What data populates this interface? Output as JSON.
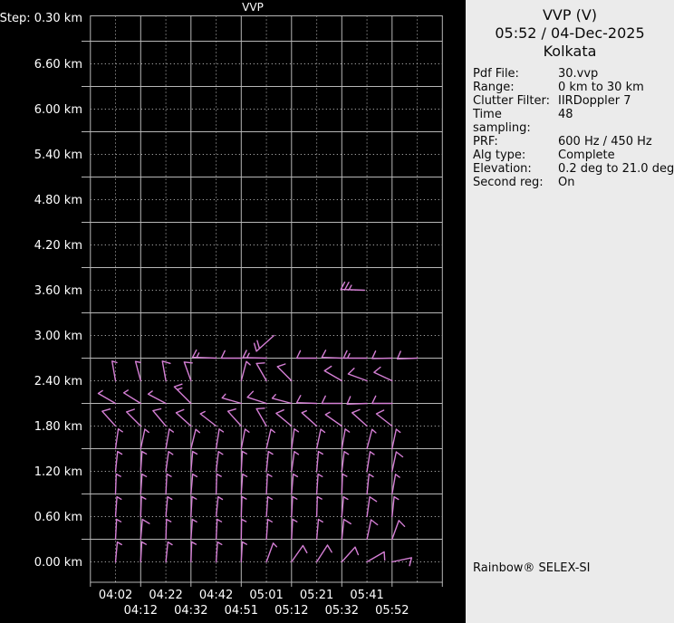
{
  "colors": {
    "background": "#000000",
    "grid_solid": "#b6b6b6",
    "grid_dotted": "#c6c6c6",
    "axis_text": "#ffffff",
    "barbs": "#d57fd5",
    "panel_bg": "#ebebeb",
    "panel_text": "#0a0a0a"
  },
  "chart": {
    "title": "VVP",
    "step_label": "Step: 0.30 km",
    "y_axis_labels": [
      "6.60 km",
      "6.00 km",
      "5.40 km",
      "4.80 km",
      "4.20 km",
      "3.60 km",
      "3.00 km",
      "2.40 km",
      "1.80 km",
      "1.20 km",
      "0.60 km",
      "0.00 km"
    ],
    "x_axis_row1": [
      "04:02",
      "04:22",
      "04:42",
      "05:01",
      "05:21",
      "05:41"
    ],
    "x_axis_row2": [
      "04:12",
      "04:32",
      "04:51",
      "05:12",
      "05:32",
      "05:52"
    ]
  },
  "panel": {
    "title": "VVP (V)",
    "datetime": "05:52 / 04-Dec-2025",
    "site": "Kolkata",
    "fields": [
      {
        "label": "Pdf File:",
        "value": "30.vvp"
      },
      {
        "label": "Range:",
        "value": "0 km to 30 km"
      },
      {
        "label": "Clutter Filter:",
        "value": "IIRDoppler 7"
      },
      {
        "label": "Time sampling:",
        "value": "48"
      },
      {
        "label": "PRF:",
        "value": "600 Hz / 450 Hz"
      },
      {
        "label": "Alg type:",
        "value": "Complete"
      },
      {
        "label": "Elevation:",
        "value": "0.2 deg to 21.0 deg"
      },
      {
        "label": "Second reg:",
        "value": "On"
      }
    ],
    "footer": "Rainbow® SELEX-SI"
  },
  "chart_data": {
    "type": "wind_barb_profile",
    "title": "VVP",
    "site": "Kolkata",
    "xlabel": "time",
    "ylabel": "height",
    "times": [
      "04:02",
      "04:12",
      "04:22",
      "04:32",
      "04:42",
      "04:51",
      "05:01",
      "05:12",
      "05:21",
      "05:32",
      "05:41",
      "05:52"
    ],
    "height_step_km": 0.3,
    "height_ticks_km": [
      6.6,
      6.0,
      5.4,
      4.8,
      4.2,
      3.6,
      3.0,
      2.4,
      1.8,
      1.2,
      0.6,
      0.0
    ],
    "ylim_km": [
      0.0,
      7.2
    ],
    "grid": "on",
    "barb_units": "kt",
    "barb_rows": [
      {
        "h": 0.0,
        "cells": [
          [
            1,
            5,
            5
          ],
          [
            2,
            3,
            5
          ],
          [
            3,
            6,
            5
          ],
          [
            4,
            2,
            5
          ],
          [
            5,
            4,
            5
          ],
          [
            6,
            3,
            5
          ],
          [
            7,
            20,
            5
          ],
          [
            8,
            35,
            10
          ],
          [
            9,
            33,
            10
          ],
          [
            10,
            42,
            10
          ],
          [
            11,
            60,
            10
          ],
          [
            12,
            78,
            10
          ]
        ]
      },
      {
        "h": 0.3,
        "cells": [
          [
            1,
            3,
            5
          ],
          [
            2,
            5,
            10
          ],
          [
            3,
            2,
            5
          ],
          [
            4,
            4,
            5
          ],
          [
            5,
            3,
            5
          ],
          [
            6,
            1,
            5
          ],
          [
            7,
            4,
            5
          ],
          [
            8,
            3,
            5
          ],
          [
            9,
            5,
            5
          ],
          [
            10,
            6,
            10
          ],
          [
            11,
            12,
            10
          ],
          [
            12,
            20,
            10
          ]
        ]
      },
      {
        "h": 0.6,
        "cells": [
          [
            1,
            4,
            5
          ],
          [
            2,
            2,
            5
          ],
          [
            3,
            5,
            5
          ],
          [
            4,
            3,
            5
          ],
          [
            5,
            6,
            5
          ],
          [
            6,
            2,
            5
          ],
          [
            7,
            4,
            5
          ],
          [
            8,
            3,
            5
          ],
          [
            9,
            2,
            5
          ],
          [
            10,
            5,
            5
          ],
          [
            11,
            8,
            10
          ],
          [
            12,
            6,
            5
          ]
        ]
      },
      {
        "h": 0.9,
        "cells": [
          [
            1,
            2,
            5
          ],
          [
            2,
            4,
            5
          ],
          [
            3,
            3,
            5
          ],
          [
            4,
            5,
            5
          ],
          [
            5,
            2,
            5
          ],
          [
            6,
            4,
            5
          ],
          [
            7,
            3,
            5
          ],
          [
            8,
            5,
            5
          ],
          [
            9,
            4,
            5
          ],
          [
            10,
            2,
            5
          ],
          [
            11,
            6,
            5
          ],
          [
            12,
            10,
            5
          ]
        ]
      },
      {
        "h": 1.2,
        "cells": [
          [
            1,
            6,
            5
          ],
          [
            2,
            4,
            5
          ],
          [
            3,
            8,
            5
          ],
          [
            4,
            5,
            5
          ],
          [
            5,
            7,
            5
          ],
          [
            6,
            3,
            5
          ],
          [
            7,
            6,
            5
          ],
          [
            8,
            8,
            5
          ],
          [
            9,
            5,
            5
          ],
          [
            10,
            7,
            5
          ],
          [
            11,
            9,
            5
          ],
          [
            12,
            12,
            10
          ]
        ]
      },
      {
        "h": 1.5,
        "cells": [
          [
            1,
            8,
            5
          ],
          [
            2,
            12,
            5
          ],
          [
            3,
            10,
            5
          ],
          [
            4,
            14,
            5
          ],
          [
            5,
            9,
            5
          ],
          [
            6,
            11,
            5
          ],
          [
            7,
            13,
            5
          ],
          [
            8,
            8,
            5
          ],
          [
            9,
            12,
            5
          ],
          [
            10,
            10,
            5
          ],
          [
            11,
            15,
            5
          ],
          [
            12,
            12,
            5
          ]
        ]
      },
      {
        "h": 1.8,
        "cells": [
          [
            1,
            318,
            10
          ],
          [
            2,
            315,
            10
          ],
          [
            3,
            320,
            10
          ],
          [
            4,
            312,
            10
          ],
          [
            5,
            308,
            5
          ],
          [
            6,
            318,
            10
          ],
          [
            7,
            330,
            10
          ],
          [
            8,
            310,
            10
          ],
          [
            9,
            312,
            5
          ],
          [
            10,
            305,
            5
          ],
          [
            11,
            312,
            10
          ],
          [
            12,
            308,
            10
          ]
        ]
      },
      {
        "h": 2.1,
        "cells": [
          [
            1,
            300,
            5
          ],
          [
            2,
            302,
            5
          ],
          [
            3,
            298,
            5
          ],
          [
            4,
            315,
            15
          ],
          [
            6,
            286,
            5
          ],
          [
            7,
            288,
            10
          ],
          [
            8,
            285,
            5
          ],
          [
            9,
            272,
            10
          ],
          [
            10,
            270,
            10
          ],
          [
            11,
            268,
            10
          ],
          [
            12,
            270,
            10
          ]
        ]
      },
      {
        "h": 2.4,
        "cells": [
          [
            1,
            350,
            5
          ],
          [
            2,
            345,
            5
          ],
          [
            3,
            350,
            10
          ],
          [
            4,
            340,
            10
          ],
          [
            6,
            15,
            5
          ],
          [
            7,
            330,
            10
          ],
          [
            8,
            315,
            10
          ],
          [
            10,
            300,
            10
          ],
          [
            11,
            290,
            10
          ],
          [
            12,
            295,
            10
          ]
        ]
      },
      {
        "h": 2.7,
        "cells": [
          [
            5,
            272,
            15
          ],
          [
            6,
            270,
            10
          ],
          [
            7,
            271,
            15
          ],
          [
            9,
            270,
            10
          ],
          [
            10,
            272,
            10
          ],
          [
            11,
            270,
            15
          ],
          [
            12,
            269,
            10
          ],
          [
            13,
            268,
            10
          ]
        ]
      },
      {
        "h": 3.0,
        "cells": [
          [
            7.3,
            228,
            20
          ]
        ]
      },
      {
        "h": 3.6,
        "cells": [
          [
            10.9,
            272,
            25
          ]
        ]
      }
    ],
    "barb_cell_format": [
      "time_column_index(1-12)",
      "direction_deg(0=up,cw)",
      "speed_kt"
    ]
  }
}
